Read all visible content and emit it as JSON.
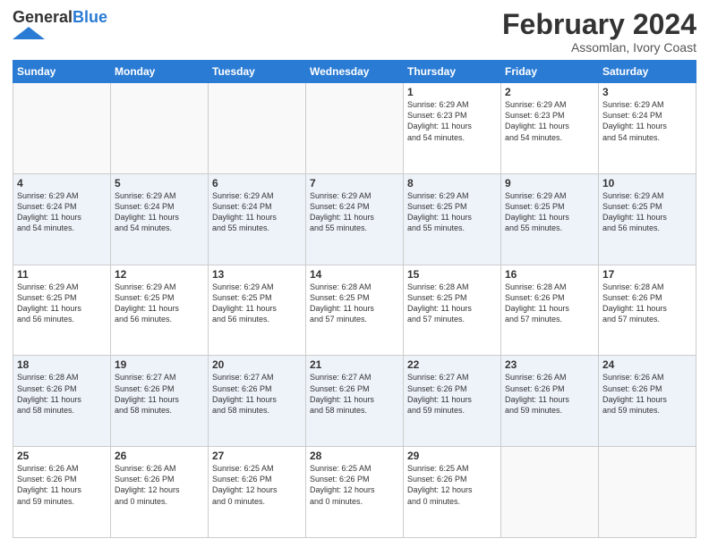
{
  "logo": {
    "general": "General",
    "blue": "Blue"
  },
  "header": {
    "month_year": "February 2024",
    "location": "Assomlan, Ivory Coast"
  },
  "weekdays": [
    "Sunday",
    "Monday",
    "Tuesday",
    "Wednesday",
    "Thursday",
    "Friday",
    "Saturday"
  ],
  "weeks": [
    [
      {
        "day": "",
        "info": ""
      },
      {
        "day": "",
        "info": ""
      },
      {
        "day": "",
        "info": ""
      },
      {
        "day": "",
        "info": ""
      },
      {
        "day": "1",
        "info": "Sunrise: 6:29 AM\nSunset: 6:23 PM\nDaylight: 11 hours\nand 54 minutes."
      },
      {
        "day": "2",
        "info": "Sunrise: 6:29 AM\nSunset: 6:23 PM\nDaylight: 11 hours\nand 54 minutes."
      },
      {
        "day": "3",
        "info": "Sunrise: 6:29 AM\nSunset: 6:24 PM\nDaylight: 11 hours\nand 54 minutes."
      }
    ],
    [
      {
        "day": "4",
        "info": "Sunrise: 6:29 AM\nSunset: 6:24 PM\nDaylight: 11 hours\nand 54 minutes."
      },
      {
        "day": "5",
        "info": "Sunrise: 6:29 AM\nSunset: 6:24 PM\nDaylight: 11 hours\nand 54 minutes."
      },
      {
        "day": "6",
        "info": "Sunrise: 6:29 AM\nSunset: 6:24 PM\nDaylight: 11 hours\nand 55 minutes."
      },
      {
        "day": "7",
        "info": "Sunrise: 6:29 AM\nSunset: 6:24 PM\nDaylight: 11 hours\nand 55 minutes."
      },
      {
        "day": "8",
        "info": "Sunrise: 6:29 AM\nSunset: 6:25 PM\nDaylight: 11 hours\nand 55 minutes."
      },
      {
        "day": "9",
        "info": "Sunrise: 6:29 AM\nSunset: 6:25 PM\nDaylight: 11 hours\nand 55 minutes."
      },
      {
        "day": "10",
        "info": "Sunrise: 6:29 AM\nSunset: 6:25 PM\nDaylight: 11 hours\nand 56 minutes."
      }
    ],
    [
      {
        "day": "11",
        "info": "Sunrise: 6:29 AM\nSunset: 6:25 PM\nDaylight: 11 hours\nand 56 minutes."
      },
      {
        "day": "12",
        "info": "Sunrise: 6:29 AM\nSunset: 6:25 PM\nDaylight: 11 hours\nand 56 minutes."
      },
      {
        "day": "13",
        "info": "Sunrise: 6:29 AM\nSunset: 6:25 PM\nDaylight: 11 hours\nand 56 minutes."
      },
      {
        "day": "14",
        "info": "Sunrise: 6:28 AM\nSunset: 6:25 PM\nDaylight: 11 hours\nand 57 minutes."
      },
      {
        "day": "15",
        "info": "Sunrise: 6:28 AM\nSunset: 6:25 PM\nDaylight: 11 hours\nand 57 minutes."
      },
      {
        "day": "16",
        "info": "Sunrise: 6:28 AM\nSunset: 6:26 PM\nDaylight: 11 hours\nand 57 minutes."
      },
      {
        "day": "17",
        "info": "Sunrise: 6:28 AM\nSunset: 6:26 PM\nDaylight: 11 hours\nand 57 minutes."
      }
    ],
    [
      {
        "day": "18",
        "info": "Sunrise: 6:28 AM\nSunset: 6:26 PM\nDaylight: 11 hours\nand 58 minutes."
      },
      {
        "day": "19",
        "info": "Sunrise: 6:27 AM\nSunset: 6:26 PM\nDaylight: 11 hours\nand 58 minutes."
      },
      {
        "day": "20",
        "info": "Sunrise: 6:27 AM\nSunset: 6:26 PM\nDaylight: 11 hours\nand 58 minutes."
      },
      {
        "day": "21",
        "info": "Sunrise: 6:27 AM\nSunset: 6:26 PM\nDaylight: 11 hours\nand 58 minutes."
      },
      {
        "day": "22",
        "info": "Sunrise: 6:27 AM\nSunset: 6:26 PM\nDaylight: 11 hours\nand 59 minutes."
      },
      {
        "day": "23",
        "info": "Sunrise: 6:26 AM\nSunset: 6:26 PM\nDaylight: 11 hours\nand 59 minutes."
      },
      {
        "day": "24",
        "info": "Sunrise: 6:26 AM\nSunset: 6:26 PM\nDaylight: 11 hours\nand 59 minutes."
      }
    ],
    [
      {
        "day": "25",
        "info": "Sunrise: 6:26 AM\nSunset: 6:26 PM\nDaylight: 11 hours\nand 59 minutes."
      },
      {
        "day": "26",
        "info": "Sunrise: 6:26 AM\nSunset: 6:26 PM\nDaylight: 12 hours\nand 0 minutes."
      },
      {
        "day": "27",
        "info": "Sunrise: 6:25 AM\nSunset: 6:26 PM\nDaylight: 12 hours\nand 0 minutes."
      },
      {
        "day": "28",
        "info": "Sunrise: 6:25 AM\nSunset: 6:26 PM\nDaylight: 12 hours\nand 0 minutes."
      },
      {
        "day": "29",
        "info": "Sunrise: 6:25 AM\nSunset: 6:26 PM\nDaylight: 12 hours\nand 0 minutes."
      },
      {
        "day": "",
        "info": ""
      },
      {
        "day": "",
        "info": ""
      }
    ]
  ]
}
